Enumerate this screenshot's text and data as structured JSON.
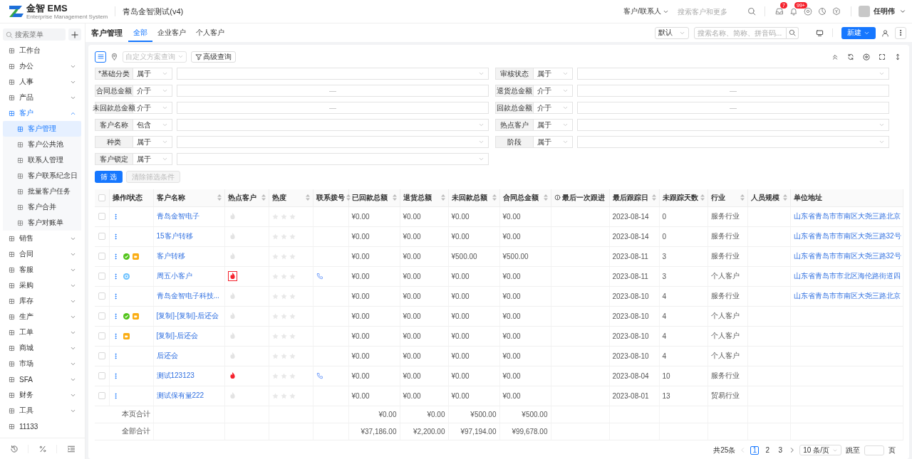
{
  "header": {
    "brand": "金智 EMS",
    "brand_subtitle": "Enterprise Management System",
    "app_title": "青岛金智测试(v4)",
    "search_scope": "客户/联系人",
    "search_placeholder": "搜索客户和更多",
    "icons": [
      {
        "kind": "inbox",
        "badge": "7"
      },
      {
        "kind": "bell",
        "badge": "99+"
      },
      {
        "kind": "settings"
      },
      {
        "kind": "chart"
      },
      {
        "kind": "hexagon"
      }
    ],
    "user_name": "任明伟"
  },
  "sidebar": {
    "search_placeholder": "搜索菜单",
    "items": [
      {
        "label": "工作台",
        "kind": "link",
        "selected": false
      },
      {
        "label": "办公",
        "kind": "group",
        "expanded": false,
        "selected": false
      },
      {
        "label": "人事",
        "kind": "group",
        "expanded": false,
        "selected": false
      },
      {
        "label": "产品",
        "kind": "group",
        "expanded": false,
        "selected": false
      },
      {
        "label": "客户",
        "kind": "group",
        "expanded": true,
        "selected": true,
        "children": [
          {
            "label": "客户管理",
            "selected": true
          },
          {
            "label": "客户公共池",
            "selected": false
          },
          {
            "label": "联系人管理",
            "selected": false
          },
          {
            "label": "客户联系纪念日",
            "selected": false
          },
          {
            "label": "批量客户任务",
            "selected": false
          },
          {
            "label": "客户合并",
            "selected": false
          },
          {
            "label": "客户对账单",
            "selected": false
          }
        ]
      },
      {
        "label": "销售",
        "kind": "group",
        "expanded": false,
        "selected": false
      },
      {
        "label": "合同",
        "kind": "group",
        "expanded": false,
        "selected": false
      },
      {
        "label": "客服",
        "kind": "group",
        "expanded": false,
        "selected": false
      },
      {
        "label": "采购",
        "kind": "group",
        "expanded": false,
        "selected": false
      },
      {
        "label": "库存",
        "kind": "group",
        "expanded": false,
        "selected": false
      },
      {
        "label": "生产",
        "kind": "group",
        "expanded": false,
        "selected": false
      },
      {
        "label": "工单",
        "kind": "group",
        "expanded": false,
        "selected": false
      },
      {
        "label": "商城",
        "kind": "group",
        "expanded": false,
        "selected": false
      },
      {
        "label": "市场",
        "kind": "group",
        "expanded": false,
        "selected": false
      },
      {
        "label": "SFA",
        "kind": "group",
        "expanded": false,
        "selected": false
      },
      {
        "label": "财务",
        "kind": "group",
        "expanded": false,
        "selected": false
      },
      {
        "label": "工具",
        "kind": "group",
        "expanded": false,
        "selected": false
      },
      {
        "label": "11133",
        "kind": "link",
        "selected": false
      }
    ],
    "footer_icons": [
      {
        "kind": "history"
      },
      {
        "kind": "percent"
      },
      {
        "kind": "indent"
      }
    ]
  },
  "page": {
    "title": "客户管理",
    "tabs": [
      {
        "label": "全部",
        "selected": true
      },
      {
        "label": "企业客户",
        "selected": false
      },
      {
        "label": "个人客户",
        "selected": false
      }
    ],
    "view": "默认",
    "search_placeholder": "搜索名称、简称、拼音码...",
    "new_button": "新建"
  },
  "filter": {
    "scheme_placeholder": "自定义方案查询",
    "advanced_button": "高级查询",
    "fields": [
      {
        "label": "*基础分类",
        "operator": "属于",
        "kind": "select"
      },
      {
        "label": "审核状态",
        "operator": "属于",
        "kind": "select"
      },
      {
        "label": "合同总金额",
        "operator": "介于",
        "kind": "range",
        "separator": "—"
      },
      {
        "label": "退货总金额",
        "operator": "介于",
        "kind": "range",
        "separator": "—"
      },
      {
        "label": "未回款总金额",
        "operator": "介于",
        "kind": "range",
        "separator": "—"
      },
      {
        "label": "回款总金额",
        "operator": "介于",
        "kind": "range",
        "separator": "—"
      },
      {
        "label": "客户名称",
        "operator": "包含",
        "kind": "select"
      },
      {
        "label": "热点客户",
        "operator": "属于",
        "kind": "select"
      },
      {
        "label": "种类",
        "operator": "属于",
        "kind": "select"
      },
      {
        "label": "阶段",
        "operator": "属于",
        "kind": "select"
      },
      {
        "label": "客户锁定",
        "operator": "属于",
        "kind": "select"
      }
    ],
    "submit_button": "筛 选",
    "clear_button": {
      "label": "清除筛选条件",
      "disabled": true
    }
  },
  "table": {
    "all_checked": false,
    "columns": [
      {
        "kind": "check"
      },
      {
        "kind": "ops",
        "label": "操作/状态",
        "sortable": false
      },
      {
        "kind": "name",
        "label": "客户名称",
        "sortable": true
      },
      {
        "kind": "hot",
        "label": "热点客户",
        "sortable": true
      },
      {
        "kind": "heat",
        "label": "热度",
        "sortable": true
      },
      {
        "kind": "phone",
        "label": "联系拨号",
        "sortable": true
      },
      {
        "kind": "paid",
        "label": "已回款总额",
        "sortable": true
      },
      {
        "kind": "returns",
        "label": "退货总额",
        "sortable": true
      },
      {
        "kind": "unpaid",
        "label": "未回款总额",
        "sortable": true
      },
      {
        "kind": "contract",
        "label": "合同总金额",
        "sortable": true
      },
      {
        "kind": "last_follow",
        "label": "最后一次跟进",
        "sortable": false,
        "info": true
      },
      {
        "kind": "last_date",
        "label": "最后跟踪日",
        "sortable": true
      },
      {
        "kind": "days",
        "label": "未跟踪天数",
        "sortable": true
      },
      {
        "kind": "industry",
        "label": "行业",
        "sortable": true
      },
      {
        "kind": "size",
        "label": "人员规模",
        "sortable": true
      },
      {
        "kind": "address",
        "label": "单位地址",
        "sortable": false
      }
    ],
    "rows": [
      {
        "checked": false,
        "status": [],
        "name": "青岛金智电子",
        "hot": false,
        "stars": 0,
        "phone": false,
        "paid": "¥0.00",
        "returns": "¥0.00",
        "unpaid": "¥0.00",
        "contract": "¥0.00",
        "last_date": "2023-08-14",
        "days": "0",
        "industry": "服务行业",
        "address": "山东省青岛市市南区大尧三路北京"
      },
      {
        "checked": false,
        "status": [],
        "name": "15客户转移",
        "hot": false,
        "stars": 0,
        "phone": false,
        "paid": "¥0.00",
        "returns": "¥0.00",
        "unpaid": "¥0.00",
        "contract": "¥0.00",
        "last_date": "2023-08-14",
        "days": "0",
        "industry": "服务行业",
        "address": "山东省青岛市市南区大尧三路32号"
      },
      {
        "checked": false,
        "status": [
          {
            "kind": "approved"
          },
          {
            "kind": "note"
          }
        ],
        "name": "客户转移",
        "hot": false,
        "stars": 0,
        "phone": false,
        "paid": "¥0.00",
        "returns": "¥0.00",
        "unpaid": "¥500.00",
        "contract": "¥500.00",
        "last_date": "2023-08-11",
        "days": "3",
        "industry": "服务行业",
        "address": "山东省青岛市市南区大尧三路32号"
      },
      {
        "checked": false,
        "status": [
          {
            "kind": "pending"
          }
        ],
        "name": "周五小客户",
        "hot": true,
        "hot_selected": true,
        "stars": 0,
        "phone": true,
        "paid": "¥0.00",
        "returns": "¥0.00",
        "unpaid": "¥0.00",
        "contract": "¥0.00",
        "last_date": "2023-08-11",
        "days": "3",
        "industry": "个人客户",
        "address": "山东省青岛市市北区海伦路街道四"
      },
      {
        "checked": false,
        "status": [],
        "name": "青岛金智电子科技...",
        "hot": false,
        "stars": 0,
        "phone": false,
        "paid": "¥0.00",
        "returns": "¥0.00",
        "unpaid": "¥0.00",
        "contract": "¥0.00",
        "last_date": "2023-08-10",
        "days": "4",
        "industry": "服务行业",
        "address": "山东省青岛市市南区大尧三路北京"
      },
      {
        "checked": false,
        "status": [
          {
            "kind": "approved"
          },
          {
            "kind": "note"
          }
        ],
        "name": "[复制]-[复制]-后还会",
        "hot": false,
        "stars": 0,
        "phone": false,
        "paid": "¥0.00",
        "returns": "¥0.00",
        "unpaid": "¥0.00",
        "contract": "¥0.00",
        "last_date": "2023-08-10",
        "days": "4",
        "industry": "个人客户"
      },
      {
        "checked": false,
        "status": [
          {
            "kind": "note"
          }
        ],
        "name": "[复制]-后还会",
        "hot": false,
        "stars": 0,
        "phone": false,
        "paid": "¥0.00",
        "returns": "¥0.00",
        "unpaid": "¥0.00",
        "contract": "¥0.00",
        "last_date": "2023-08-10",
        "days": "4",
        "industry": "个人客户"
      },
      {
        "checked": false,
        "status": [],
        "name": "后还会",
        "hot": false,
        "stars": 0,
        "phone": false,
        "paid": "¥0.00",
        "returns": "¥0.00",
        "unpaid": "¥0.00",
        "contract": "¥0.00",
        "last_date": "2023-08-10",
        "days": "4",
        "industry": "个人客户"
      },
      {
        "checked": false,
        "status": [],
        "name": "测试123123",
        "hot": true,
        "stars": 0,
        "phone": true,
        "paid": "¥0.00",
        "returns": "¥0.00",
        "unpaid": "¥0.00",
        "contract": "¥0.00",
        "last_date": "2023-08-04",
        "days": "10",
        "industry": "服务行业"
      },
      {
        "checked": false,
        "status": [],
        "name": "测试保有量222",
        "hot": false,
        "stars": 0,
        "phone": false,
        "paid": "¥0.00",
        "returns": "¥0.00",
        "unpaid": "¥0.00",
        "contract": "¥0.00",
        "last_date": "2023-08-01",
        "days": "13",
        "industry": "贸易行业"
      }
    ],
    "totals": [
      {
        "label": "本页合计",
        "paid": "¥0.00",
        "returns": "¥0.00",
        "unpaid": "¥500.00",
        "contract": "¥500.00"
      },
      {
        "label": "全部合计",
        "paid": "¥37,186.00",
        "returns": "¥2,200.00",
        "unpaid": "¥97,194.00",
        "contract": "¥99,678.00"
      }
    ]
  },
  "pagination": {
    "total": "共25条",
    "prev_disabled": true,
    "next_disabled": false,
    "pages": [
      {
        "label": "1",
        "selected": true
      },
      {
        "label": "2",
        "selected": false
      },
      {
        "label": "3",
        "selected": false
      }
    ],
    "page_size": "10 条/页",
    "jump_label": "跳至",
    "page_unit": "页"
  }
}
